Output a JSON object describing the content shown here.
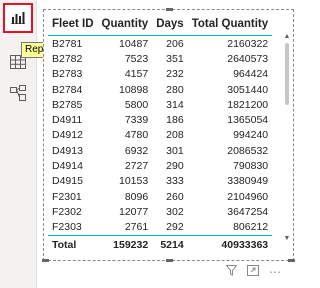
{
  "sidebar": {
    "items": [
      {
        "name": "report",
        "icon": "bar-chart-icon"
      },
      {
        "name": "data",
        "icon": "table-grid-icon"
      },
      {
        "name": "model",
        "icon": "model-icon"
      }
    ],
    "tooltip": "Report",
    "highlight_color": "#e81123"
  },
  "table": {
    "columns": [
      "Fleet ID",
      "Quantity",
      "Days",
      "Total Quantity"
    ],
    "rows": [
      [
        "B2781",
        "10487",
        "206",
        "2160322"
      ],
      [
        "B2782",
        "7523",
        "351",
        "2640573"
      ],
      [
        "B2783",
        "4157",
        "232",
        "964424"
      ],
      [
        "B2784",
        "10898",
        "280",
        "3051440"
      ],
      [
        "B2785",
        "5800",
        "314",
        "1821200"
      ],
      [
        "D4911",
        "7339",
        "186",
        "1365054"
      ],
      [
        "D4912",
        "4780",
        "208",
        "994240"
      ],
      [
        "D4913",
        "6932",
        "301",
        "2086532"
      ],
      [
        "D4914",
        "2727",
        "290",
        "790830"
      ],
      [
        "D4915",
        "10153",
        "333",
        "3380949"
      ],
      [
        "F2301",
        "8096",
        "260",
        "2104960"
      ],
      [
        "F2302",
        "12077",
        "302",
        "3647254"
      ],
      [
        "F2303",
        "2761",
        "292",
        "806212"
      ]
    ],
    "total": [
      "Total",
      "159232",
      "5214",
      "40933363"
    ],
    "accent_color": "#00b7c3"
  },
  "visual_actions": [
    "filter-icon",
    "focus-mode-icon",
    "more-options-icon"
  ]
}
